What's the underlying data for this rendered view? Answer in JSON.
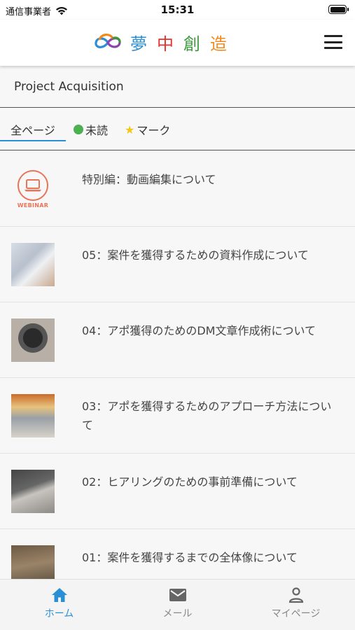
{
  "status_bar": {
    "carrier": "通信事業者",
    "time": "15:31",
    "battery_level": 1.0
  },
  "header": {
    "logo_text": [
      "夢",
      "中",
      "創",
      "造"
    ],
    "logo_colors": [
      "#2b8fd6",
      "#e2322e",
      "#3a9a3b",
      "#f08a1d"
    ],
    "menu_icon": "hamburger-menu-icon"
  },
  "section": {
    "title": "Project Acquisition"
  },
  "tabs": {
    "all": "全ページ",
    "unread": "未読",
    "mark": "マーク",
    "selected": "all",
    "accent": "#2b8fd6"
  },
  "items": [
    {
      "title": "特別編：動画編集について",
      "thumb_label": "WEBINAR",
      "thumb_icon": "laptop-icon"
    },
    {
      "title": "05：案件を獲得するための資料作成について"
    },
    {
      "title": "04：アポ獲得のためのDM文章作成術について"
    },
    {
      "title": "03：アポを獲得するためのアプローチ方法について"
    },
    {
      "title": "02：ヒアリングのための事前準備について"
    },
    {
      "title": "01：案件を獲得するまでの全体像について"
    }
  ],
  "bottom_nav": [
    {
      "label": "ホーム",
      "icon": "home-icon",
      "active": true
    },
    {
      "label": "メール",
      "icon": "mail-icon",
      "active": false
    },
    {
      "label": "マイページ",
      "icon": "person-icon",
      "active": false
    }
  ]
}
